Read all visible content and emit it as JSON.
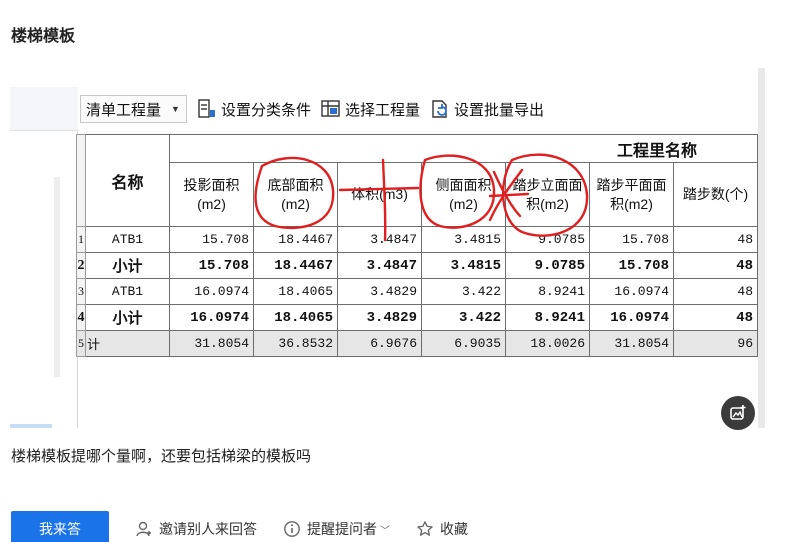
{
  "question": {
    "title": "楼梯模板",
    "body": "楼梯模板提哪个量啊，还要包括梯梁的模板吗"
  },
  "toolbar": {
    "select_value": "清单工程量",
    "btn_classify": "设置分类条件",
    "btn_select_qty": "选择工程量",
    "btn_export": "设置批量导出"
  },
  "table": {
    "group_header": "工程里名称",
    "name_header": "名称",
    "columns": [
      "投影面积(m2)",
      "底部面积(m2)",
      "体积(m3)",
      "侧面面积(m2)",
      "踏步立面面积(m2)",
      "踏步平面面积(m2)",
      "踏步数(个)"
    ],
    "rows": [
      {
        "no": "1",
        "name": "ATB1",
        "cells": [
          "15.708",
          "18.4467",
          "3.4847",
          "3.4815",
          "9.0785",
          "15.708",
          "48"
        ]
      },
      {
        "no": "2",
        "name": "小计",
        "cells": [
          "15.708",
          "18.4467",
          "3.4847",
          "3.4815",
          "9.0785",
          "15.708",
          "48"
        ]
      },
      {
        "no": "3",
        "name": "ATB1",
        "cells": [
          "16.0974",
          "18.4065",
          "3.4829",
          "3.422",
          "8.9241",
          "16.0974",
          "48"
        ]
      },
      {
        "no": "4",
        "name": "小计",
        "cells": [
          "16.0974",
          "18.4065",
          "3.4829",
          "3.422",
          "8.9241",
          "16.0974",
          "48"
        ]
      },
      {
        "no": "5",
        "name": "计",
        "cells": [
          "31.8054",
          "36.8532",
          "6.9676",
          "6.9035",
          "18.0026",
          "31.8054",
          "96"
        ]
      }
    ]
  },
  "actions": {
    "answer": "我来答",
    "invite": "邀请别人来回答",
    "remind": "提醒提问者",
    "favorite": "收藏"
  },
  "colors": {
    "primary": "#1a73e8",
    "annotation_red": "#e02020"
  }
}
